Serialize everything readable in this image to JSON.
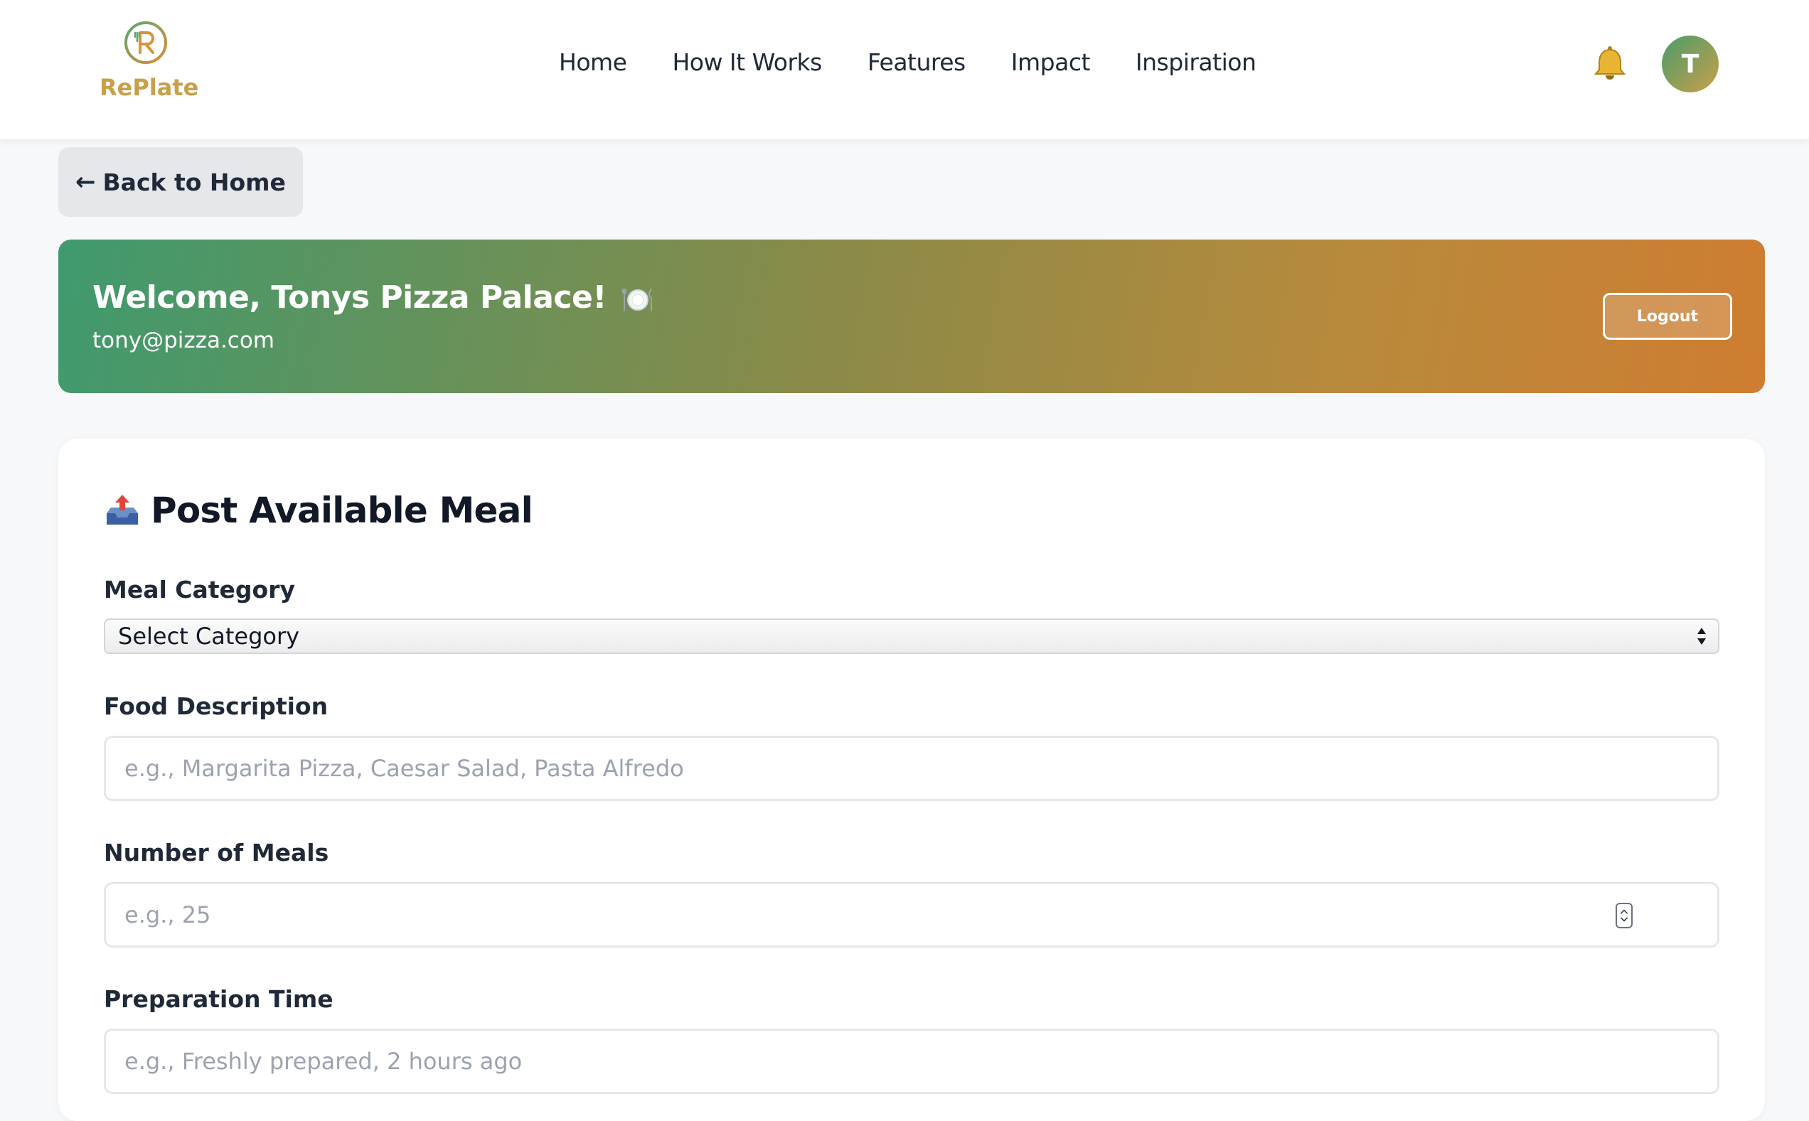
{
  "brand": {
    "name": "RePlate",
    "logo_icon": "replate-logo-icon"
  },
  "nav": {
    "items": [
      {
        "label": "Home"
      },
      {
        "label": "How It Works"
      },
      {
        "label": "Features"
      },
      {
        "label": "Impact"
      },
      {
        "label": "Inspiration"
      }
    ]
  },
  "header": {
    "bell_icon": "bell-icon",
    "avatar_initial": "T"
  },
  "back": {
    "label": "Back to Home",
    "arrow": "←"
  },
  "welcome": {
    "title": "Welcome, Tonys Pizza Palace!",
    "email": "tony@pizza.com",
    "logout_label": "Logout"
  },
  "form": {
    "title": "Post Available Meal",
    "category": {
      "label": "Meal Category",
      "value": "Select Category"
    },
    "description": {
      "label": "Food Description",
      "placeholder": "e.g., Margarita Pizza, Caesar Salad, Pasta Alfredo"
    },
    "meals": {
      "label": "Number of Meals",
      "placeholder": "e.g., 25"
    },
    "prep": {
      "label": "Preparation Time",
      "placeholder": "e.g., Freshly prepared, 2 hours ago"
    }
  },
  "colors": {
    "brand_gold": "#c9a04a",
    "banner_start": "#3f9a6e",
    "banner_end": "#cf7d30"
  }
}
